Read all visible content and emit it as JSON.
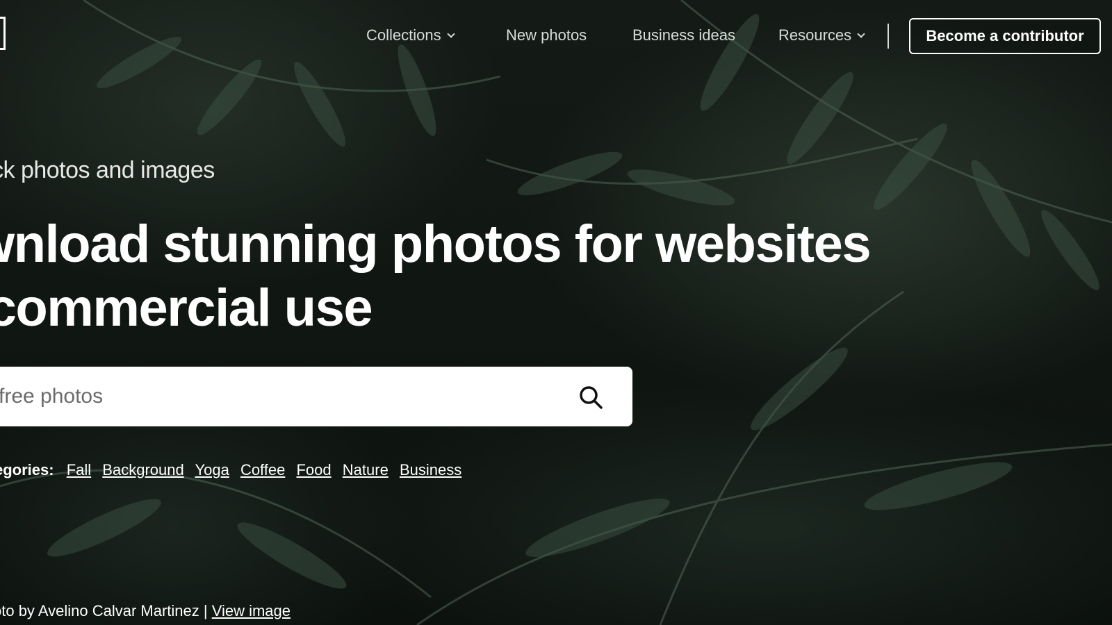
{
  "nav": {
    "items": [
      {
        "label": "Collections",
        "dropdown": true
      },
      {
        "label": "New photos",
        "dropdown": false
      },
      {
        "label": "Business ideas",
        "dropdown": false
      },
      {
        "label": "Resources",
        "dropdown": true
      }
    ],
    "cta_label": "Become a contributor"
  },
  "hero": {
    "eyebrow": "ck photos and images",
    "headline_line1": "wnload stunning photos for websites",
    "headline_line2": " commercial use"
  },
  "search": {
    "placeholder": "free photos",
    "icon": "search-icon"
  },
  "categories": {
    "label": "egories:",
    "links": [
      "Fall",
      "Background",
      "Yoga",
      "Coffee",
      "Food",
      "Nature",
      "Business"
    ]
  },
  "credit": {
    "text": "oto by Avelino Calvar Martinez | ",
    "link_label": "View image"
  },
  "colors": {
    "background": "#111813",
    "text": "#ffffff",
    "nav_text": "#d9ddd9"
  }
}
